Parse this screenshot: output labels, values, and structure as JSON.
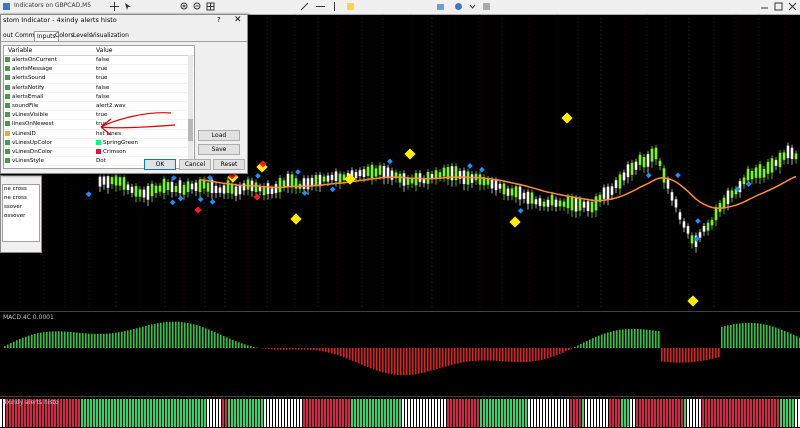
{
  "window": {
    "title": "Indicators on GBPCAD,M5"
  },
  "dialog": {
    "title": "stom Indicator - 4xindy alerts histo",
    "help": "?",
    "close": "✕",
    "tabs": [
      "out",
      "Common",
      "Inputs",
      "Colors",
      "Levels",
      "Visualization"
    ],
    "active_tab": "Inputs",
    "table_headers": {
      "variable": "Variable",
      "value": "Value"
    },
    "rows": [
      {
        "name": "alertsOnCurrent",
        "value": "false"
      },
      {
        "name": "alertsMessage",
        "value": "true"
      },
      {
        "name": "alertsSound",
        "value": "true"
      },
      {
        "name": "alertsNotify",
        "value": "false"
      },
      {
        "name": "alertsEmail",
        "value": "false"
      },
      {
        "name": "soundFile",
        "value": "alert2.wav"
      },
      {
        "name": "vLinesVisible",
        "value": "true"
      },
      {
        "name": "linesOnNewest",
        "value": "true"
      },
      {
        "name": "vLinesID",
        "value": "hst Lines"
      },
      {
        "name": "vLinesUpColor",
        "value": "SpringGreen"
      },
      {
        "name": "vLinesDnColor",
        "value": "Crimson"
      },
      {
        "name": "vLinesStyle",
        "value": "Dot"
      }
    ],
    "swatch_up": "#00ff7f",
    "swatch_dn": "#dc143c",
    "buttons": {
      "load": "Load",
      "save": "Save",
      "ok": "OK",
      "cancel": "Cancel",
      "reset": "Reset"
    }
  },
  "side_panel": {
    "items": [
      "ne cross",
      "ne cross",
      "ssover",
      "ossover"
    ]
  },
  "macd": {
    "label": "MACD 4C 0.0001"
  },
  "histo": {
    "label": "4xindy alerts histo"
  },
  "colors": {
    "bull": "#7cfc00",
    "bear": "#ff2020",
    "ma": "#ff8c3c",
    "vline_up": "#00ff7f",
    "vline_dn": "#dc143c"
  }
}
